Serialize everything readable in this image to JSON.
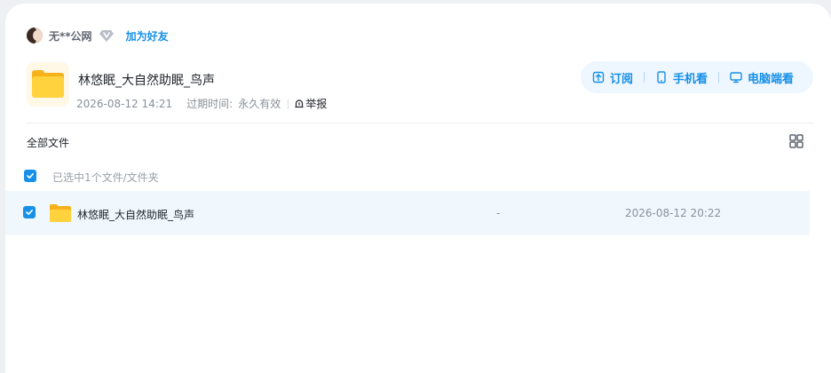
{
  "user": {
    "name": "无**公网",
    "badge_icon": "vip-diamond-icon",
    "add_friend_label": "加为好友"
  },
  "share": {
    "title": "林悠眠_大自然助眠_鸟声",
    "created": "2026-08-12 14:21",
    "expiry_label": "过期时间:",
    "expiry_value": "永久有效",
    "report_label": "举报"
  },
  "actions": {
    "subscribe": "订阅",
    "mobile": "手机看",
    "desktop": "电脑端看"
  },
  "file_list": {
    "all_files_label": "全部文件",
    "view_toggle_icon": "grid-view-icon",
    "selection_info": "已选中1个文件/文件夹",
    "rows": [
      {
        "name": "林悠眠_大自然助眠_鸟声",
        "size": "-",
        "date": "2026-08-12 20:22",
        "selected": true
      }
    ]
  },
  "colors": {
    "accent": "#1690e8",
    "folder": "#ffd23e",
    "row_highlight": "#f0f8fe",
    "action_bar_bg": "#eef6ff"
  }
}
